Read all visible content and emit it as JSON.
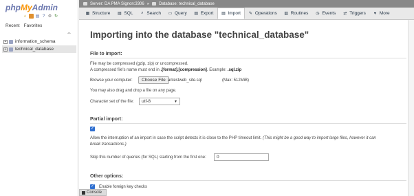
{
  "logo": {
    "php": "php",
    "my": "My",
    "admin": "Admin"
  },
  "nav_icons": [
    "home-icon",
    "logout-icon",
    "docs-icon",
    "help-icon",
    "settings-icon",
    "reload-icon"
  ],
  "nav_tabs": {
    "recent": "Recent",
    "favorites": "Favorites"
  },
  "databases": [
    {
      "name": "information_schema",
      "expander": "+"
    },
    {
      "name": "technical_database",
      "expander": "+"
    }
  ],
  "breadcrumb": {
    "server": "Server: DA PMA Signon:3306",
    "separator": "»",
    "database": "Database: technical_database"
  },
  "tabs": [
    {
      "label": "Structure",
      "icon": "structure-icon"
    },
    {
      "label": "SQL",
      "icon": "sql-icon"
    },
    {
      "label": "Search",
      "icon": "search-icon"
    },
    {
      "label": "Query",
      "icon": "query-icon"
    },
    {
      "label": "Export",
      "icon": "export-icon"
    },
    {
      "label": "Import",
      "icon": "import-icon"
    },
    {
      "label": "Operations",
      "icon": "operations-icon"
    },
    {
      "label": "Routines",
      "icon": "routines-icon"
    },
    {
      "label": "Events",
      "icon": "events-icon"
    },
    {
      "label": "Triggers",
      "icon": "triggers-icon"
    },
    {
      "label": "More",
      "icon": "chevron-down-icon"
    }
  ],
  "page_title": "Importing into the database \"technical_database\"",
  "file_import": {
    "legend": "File to import:",
    "compress_note": "File may be compressed (gzip, zip) or uncompressed.",
    "name_note_prefix": "A compressed file's name must end in ",
    "name_note_format": ".[format].[compression]",
    "name_note_mid": ". Example: ",
    "name_note_example": ".sql.zip",
    "browse_label": "Browse your computer:",
    "choose_button": "Choose File",
    "chosen_file": "antestweb_site.sql",
    "max_size": "(Max: 512MiB)",
    "drag_note": "You may also drag and drop a file on any page.",
    "charset_label": "Character set of the file:",
    "charset_value": "utf-8"
  },
  "partial_import": {
    "legend": "Partial import:",
    "allow_interrupt_checked": true,
    "allow_interrupt_text": "Allow the interruption of an import in case the script detects it is close to the PHP timeout limit.",
    "allow_interrupt_note_line1": "(This might be a good way to import large files, however it can",
    "allow_interrupt_note_line2": "break transactions.)",
    "skip_label": "Skip this number of queries (for SQL) starting from the first one:",
    "skip_value": "0"
  },
  "other_options": {
    "legend": "Other options:",
    "foreign_keys_checked": true,
    "foreign_keys_label": "Enable foreign key checks"
  },
  "console": {
    "label": "Console"
  },
  "colors": {
    "accent_blue": "#2f6fd0",
    "breadcrumb_bg": "#888888",
    "tabs_bg": "#e9e9e9"
  }
}
